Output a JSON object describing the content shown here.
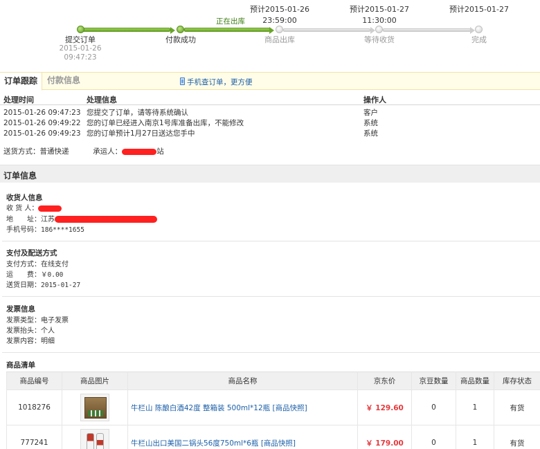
{
  "progress": {
    "steps": [
      {
        "label": "提交订单",
        "date": "2015-01-26",
        "time": "09:47:23"
      },
      {
        "label": "付款成功"
      },
      {
        "label": "商品出库",
        "estimate": "预计2015-01-26",
        "estimate_time": "23:59:00",
        "current_note": "正在出库"
      },
      {
        "label": "等待收货",
        "estimate": "预计2015-01-27",
        "estimate_time": "11:30:00"
      },
      {
        "label": "完成",
        "estimate": "预计2015-01-27"
      }
    ]
  },
  "tabs": {
    "tracking": "订单跟踪",
    "payment": "付款信息",
    "mobile_link": "手机查订单，更方便"
  },
  "tracking": {
    "headers": {
      "time": "处理时间",
      "info": "处理信息",
      "operator": "操作人"
    },
    "rows": [
      {
        "time": "2015-01-26 09:47:23",
        "info": "您提交了订单，请等待系统确认",
        "operator": "客户"
      },
      {
        "time": "2015-01-26 09:49:22",
        "info": "您的订单已经进入南京1号库准备出库，不能修改",
        "operator": "系统"
      },
      {
        "time": "2015-01-26 09:49:23",
        "info": "您的订单预计1月27日送达您手中",
        "operator": "系统"
      }
    ],
    "ship_method_label": "送货方式：",
    "ship_method": "普通快递",
    "carrier_label": "承运人：",
    "carrier_tail": "站"
  },
  "order_info": {
    "title": "订单信息",
    "receiver": {
      "title": "收货人信息",
      "name_label": "收 货 人：",
      "address_label": "地　　址：",
      "address_prefix": "江苏",
      "phone_label": "手机号码：",
      "phone": "186****1655"
    },
    "payment": {
      "title": "支付及配送方式",
      "method_label": "支付方式：",
      "method": "在线支付",
      "fee_label": "运　　费：",
      "fee": "￥0.00",
      "date_label": "送货日期：",
      "date": "2015-01-27"
    },
    "invoice": {
      "title": "发票信息",
      "type_label": "发票类型：",
      "type": "电子发票",
      "header_label": "发票抬头：",
      "header": "个人",
      "content_label": "发票内容：",
      "content": "明细"
    },
    "products": {
      "title": "商品清单",
      "columns": [
        "商品编号",
        "商品图片",
        "商品名称",
        "京东价",
        "京豆数量",
        "商品数量",
        "库存状态"
      ],
      "rows": [
        {
          "id": "1018276",
          "name": "牛栏山 陈酿白酒42度 整箱装 500ml*12瓶 [商品快照]",
          "price": "￥ 129.60",
          "beans": "0",
          "qty": "1",
          "stock": "有货"
        },
        {
          "id": "777241",
          "name": "牛栏山出口美国二锅头56度750ml*6瓶 [商品快照]",
          "price": "￥ 179.00",
          "beans": "0",
          "qty": "1",
          "stock": "有货"
        }
      ]
    }
  }
}
